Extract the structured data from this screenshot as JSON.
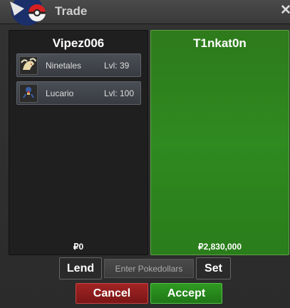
{
  "window": {
    "title": "Trade",
    "close_label": "✕"
  },
  "left_panel": {
    "player_name": "Vipez006",
    "pokemon": [
      {
        "name": "Ninetales",
        "level": "Lvl: 39"
      },
      {
        "name": "Lucario",
        "level": "Lvl: 100"
      }
    ],
    "money": "₽0"
  },
  "right_panel": {
    "player_name": "T1nkat0n",
    "money": "₽2,830,000"
  },
  "controls": {
    "lend_label": "Lend",
    "pokedollars_placeholder": "Enter Pokedollars",
    "set_label": "Set",
    "cancel_label": "Cancel",
    "accept_label": "Accept"
  },
  "colors": {
    "accent_green": "#2f8a20",
    "cancel_red": "#8e1c1c"
  }
}
